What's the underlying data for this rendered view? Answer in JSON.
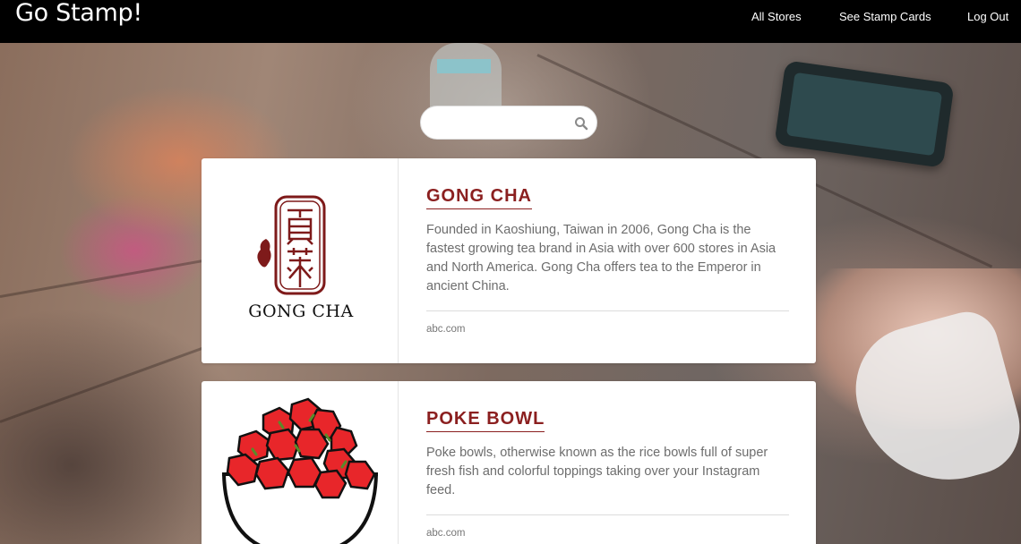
{
  "brand": "Go Stamp!",
  "nav": {
    "all_stores": "All Stores",
    "stamp_cards": "See Stamp Cards",
    "log_out": "Log Out"
  },
  "search": {
    "placeholder": "",
    "value": ""
  },
  "colors": {
    "navbar": "#000000",
    "title": "#8b1f1f",
    "description": "#6d6d6d"
  },
  "stores": [
    {
      "name": "GONG CHA",
      "logo_icon": "gong-cha-logo",
      "logo_text": "GONG CHA",
      "description": "Founded in Kaoshiung, Taiwan in 2006, Gong Cha is the fastest growing tea brand in Asia with over 600 stores in Asia and North America. Gong Cha offers tea to the Emperor in ancient China.",
      "website": "abc.com"
    },
    {
      "name": "POKE BOWL",
      "logo_icon": "poke-bowl-logo",
      "description": "Poke bowls, otherwise known as the rice bowls full of super fresh fish and colorful toppings taking over your Instagram feed.",
      "website": "abc.com"
    }
  ]
}
